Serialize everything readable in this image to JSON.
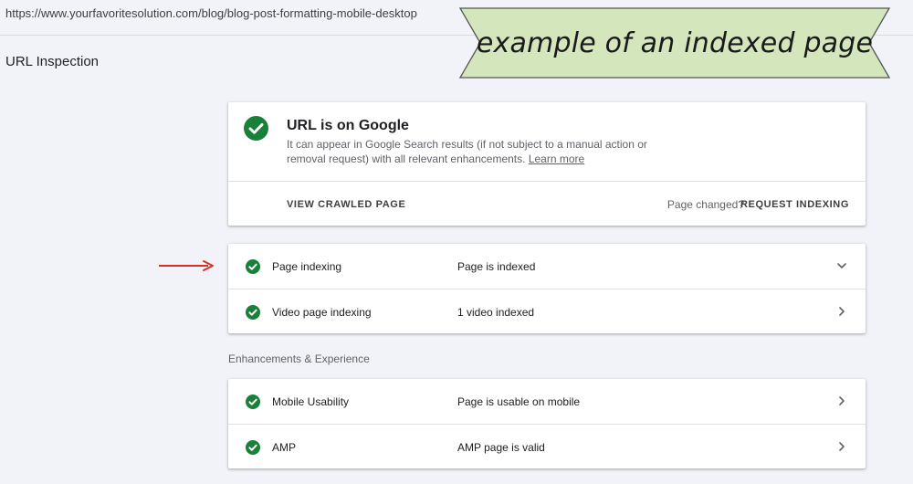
{
  "url": "https://www.yourfavoritesolution.com/blog/blog-post-formatting-mobile-desktop",
  "page_title": "URL Inspection",
  "banner": {
    "text": "example of an indexed page",
    "fill_color": "#d4e6bc"
  },
  "status": {
    "title": "URL is on Google",
    "description": "It can appear in Google Search results (if not subject to a manual action or removal request) with all relevant enhancements.",
    "learn_more": "Learn more",
    "view_crawled": "VIEW CRAWLED PAGE",
    "page_changed": "Page changed?",
    "request_indexing": "REQUEST INDEXING"
  },
  "indexing_rows": [
    {
      "label": "Page indexing",
      "value": "Page is indexed",
      "chevron": "chevron-down-icon"
    },
    {
      "label": "Video page indexing",
      "value": "1 video indexed",
      "chevron": "chevron-right-icon"
    }
  ],
  "enhancements_heading": "Enhancements & Experience",
  "enhancement_rows": [
    {
      "label": "Mobile Usability",
      "value": "Page is usable on mobile",
      "chevron": "chevron-right-icon"
    },
    {
      "label": "AMP",
      "value": "AMP page is valid",
      "chevron": "chevron-right-icon"
    }
  ],
  "colors": {
    "check_green": "#188038",
    "arrow_red": "#d93025",
    "background": "#f1f3f8"
  },
  "icons": {
    "status": "check-circle-icon",
    "annotation": "red-arrow-icon"
  }
}
